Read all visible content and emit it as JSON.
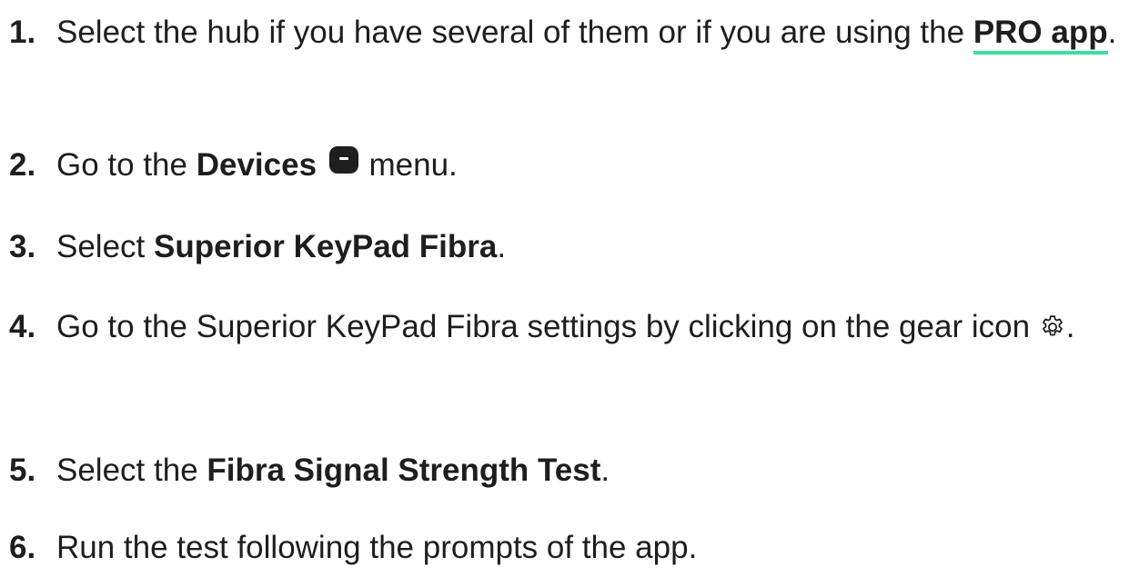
{
  "steps": [
    {
      "number": "1.",
      "text_before": "Select the hub if you have several of them or if you are using the ",
      "link_label": "PRO app",
      "text_after": "."
    },
    {
      "number": "2.",
      "text_before": "Go to the ",
      "bold": "Devices",
      "icon": "devices-menu-icon",
      "text_after": " menu."
    },
    {
      "number": "3.",
      "text_before": "Select ",
      "bold": "Superior KeyPad Fibra",
      "text_after": "."
    },
    {
      "number": "4.",
      "text_before": "Go to the Superior KeyPad Fibra settings by clicking on the gear icon ",
      "icon": "gear-icon",
      "text_after": "."
    },
    {
      "number": "5.",
      "text_before": "Select the ",
      "bold": "Fibra Signal Strength Test",
      "text_after": "."
    },
    {
      "number": "6.",
      "text_before": "Run the test following the prompts of the app."
    }
  ],
  "colors": {
    "text": "#1e1e1e",
    "link_underline": "#3fe0a0",
    "background": "#ffffff"
  }
}
